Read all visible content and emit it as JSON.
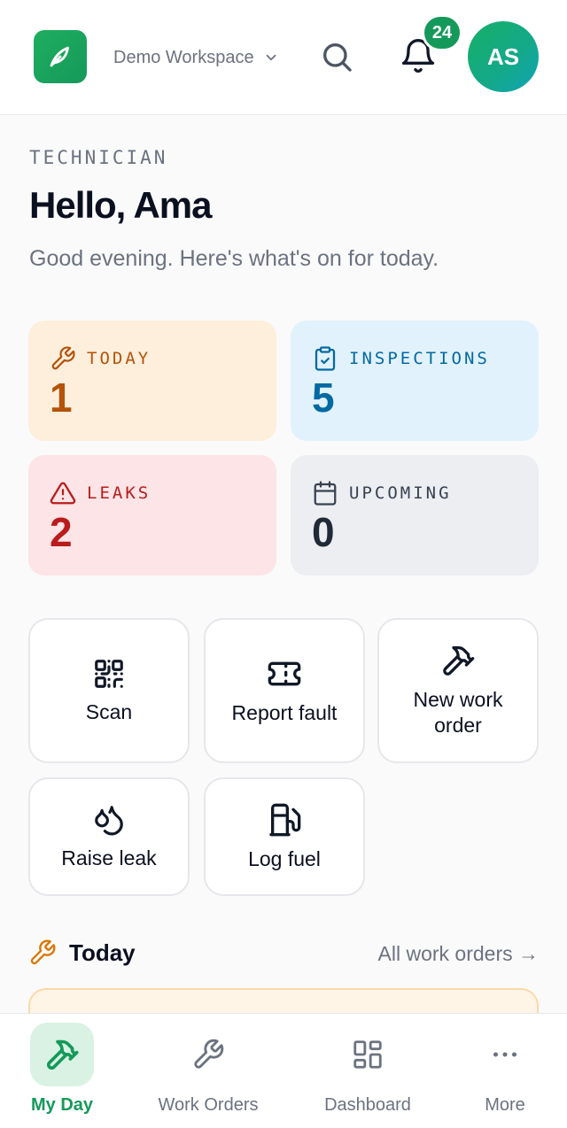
{
  "header": {
    "workspace": "Demo Workspace",
    "notifications_count": "24",
    "avatar_initials": "AS",
    "brand_color": "#15995a"
  },
  "greeting": {
    "role": "TECHNICIAN",
    "hello": "Hello, Ama",
    "subtitle": "Good evening. Here's what's on for today."
  },
  "stats": {
    "today": {
      "label": "TODAY",
      "value": "1",
      "icon": "wrench-icon",
      "color": "#b45309"
    },
    "inspections": {
      "label": "INSPECTIONS",
      "value": "5",
      "icon": "clipboard-check-icon",
      "color": "#0369a1"
    },
    "leaks": {
      "label": "LEAKS",
      "value": "2",
      "icon": "warning-triangle-icon",
      "color": "#b91c1c"
    },
    "upcoming": {
      "label": "UPCOMING",
      "value": "0",
      "icon": "calendar-icon",
      "color": "#374151"
    }
  },
  "actions": {
    "scan": {
      "label": "Scan",
      "icon": "qr-code-icon"
    },
    "report_fault": {
      "label": "Report fault",
      "icon": "ticket-icon"
    },
    "new_work_order": {
      "label": "New work order",
      "icon": "hammer-icon"
    },
    "raise_leak": {
      "label": "Raise leak",
      "icon": "droplets-icon"
    },
    "log_fuel": {
      "label": "Log fuel",
      "icon": "fuel-icon"
    }
  },
  "today_section": {
    "title": "Today",
    "link": "All work orders →"
  },
  "bottom_nav": {
    "my_day": "My Day",
    "work_orders": "Work Orders",
    "dashboard": "Dashboard",
    "more": "More"
  }
}
